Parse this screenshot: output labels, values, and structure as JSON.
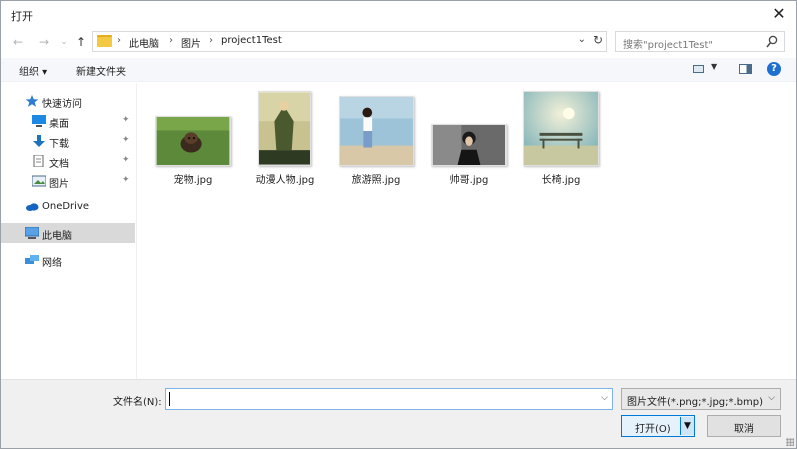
{
  "window": {
    "title": "打开",
    "close_symbol": "✕"
  },
  "navigation": {
    "back_symbol": "←",
    "forward_symbol": "→",
    "recent_symbol": "⌄",
    "up_symbol": "↑"
  },
  "address": {
    "crumbs": [
      "此电脑",
      "图片",
      "project1Test"
    ],
    "separator": "›",
    "dropdown_symbol": "⌄",
    "refresh_symbol": "↻"
  },
  "search": {
    "placeholder": "搜索\"project1Test\""
  },
  "toolbar": {
    "organize_label": "组织 ▾",
    "new_folder_label": "新建文件夹",
    "help_label": "?"
  },
  "sidebar": {
    "quick_access": "快速访问",
    "items": [
      {
        "label": "桌面",
        "icon": "desktop-icon",
        "pinned": true
      },
      {
        "label": "下载",
        "icon": "download-icon",
        "pinned": true
      },
      {
        "label": "文档",
        "icon": "document-icon",
        "pinned": true
      },
      {
        "label": "图片",
        "icon": "pictures-icon",
        "pinned": true
      }
    ],
    "onedrive": "OneDrive",
    "this_pc": "此电脑",
    "network": "网络",
    "pin_symbol": "📌"
  },
  "files": [
    {
      "name": "宠物.jpg",
      "subject": "puppy on grass"
    },
    {
      "name": "动漫人物.jpg",
      "subject": "anime character"
    },
    {
      "name": "旅游照.jpg",
      "subject": "person at beach"
    },
    {
      "name": "帅哥.jpg",
      "subject": "portrait man in dark suit"
    },
    {
      "name": "长椅.jpg",
      "subject": "bench under sky"
    }
  ],
  "footer": {
    "filename_label": "文件名(N):",
    "filename_value": "",
    "filter_value": "图片文件(*.png;*.jpg;*.bmp)",
    "open_label": "打开(O)",
    "cancel_label": "取消"
  },
  "colors": {
    "accent": "#0078d7",
    "selection": "#d9d9d9",
    "help": "#1f6fd1"
  }
}
